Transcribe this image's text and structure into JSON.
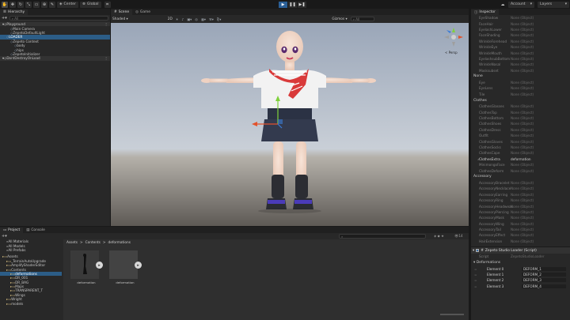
{
  "toolbar": {
    "tools": [
      "hand-icon",
      "move-icon",
      "rotate-icon",
      "scale-icon",
      "rect-icon",
      "transform-icon",
      "custom-icon"
    ],
    "pivot_label": "Center",
    "space_label": "Global",
    "account_label": "Account",
    "layers_label": "Layers"
  },
  "hierarchy": {
    "tab": "Hierarchy",
    "search_placeholder": "All",
    "items": [
      {
        "label": "Playground",
        "depth": 0,
        "selected": false,
        "scene": true
      },
      {
        "label": "Main Camera",
        "depth": 2,
        "selected": false
      },
      {
        "label": "ZepetoDefaultLight",
        "depth": 2,
        "selected": false
      },
      {
        "label": "LOADER",
        "depth": 1,
        "selected": true
      },
      {
        "label": "Zepeto Context",
        "depth": 2,
        "selected": false
      },
      {
        "label": "body",
        "depth": 3,
        "selected": false
      },
      {
        "label": "hips",
        "depth": 3,
        "selected": false
      },
      {
        "label": "ZepetoInitializer",
        "depth": 2,
        "selected": false
      },
      {
        "label": "DontDestroyOnLoad",
        "depth": 0,
        "selected": false,
        "scene": true
      }
    ]
  },
  "scene_view": {
    "tabs": [
      "Scene",
      "Game"
    ],
    "shading": "Shaded",
    "dim": "2D",
    "gizmos": "Gizmos",
    "search_placeholder": "All",
    "gizmo_label": "< Persp"
  },
  "inspector": {
    "tab": "Inspector",
    "none_value": "None (Object)",
    "groups": [
      {
        "header": "",
        "rows": [
          "EyeShadow",
          "FaceHair",
          "EyelashLower",
          "FaceShading",
          "WrinkleForehead",
          "WrinkleEye",
          "WrinkleMouth",
          "EyelashsubBottom",
          "WrinkleNasal",
          "Masksubset"
        ]
      },
      {
        "header": "None",
        "rows": [
          "Eye",
          "EyeLens",
          "Tile"
        ]
      },
      {
        "header": "Clothes",
        "rows": [
          "ClothesGlasses",
          "ClothesTop",
          "ClothesBottom",
          "ClothesShoes",
          "ClothesDress",
          "Outfit",
          "ClothesGloves",
          "ClothesSocks",
          "ClothesCape",
          "ClothesExtra",
          "MinimongoFace",
          "ClothesDeform"
        ]
      },
      {
        "header": "Accessory",
        "rows": [
          "AccessoryBracelet",
          "AccessoryNecklace",
          "AccessoryEarring",
          "AccessoryRing",
          "AccessoryHeadwear",
          "AccessoryPiercing",
          "AccessoryMask",
          "AccessoryWing",
          "AccessoryTail",
          "AccessoryEffect",
          "HairExtension"
        ]
      }
    ],
    "highlighted_row": "ClothesExtra",
    "highlighted_value": "deformation",
    "component_title": "Zepeto Studio Loader (Script)",
    "script_label": "Script",
    "script_value": "ZepetoStudioLoader",
    "deformations_label": "Deformations",
    "elements": [
      {
        "k": "Element 0",
        "v": "DEFORM_1"
      },
      {
        "k": "Element 1",
        "v": "DEFORM_2"
      },
      {
        "k": "Element 2",
        "v": "DEFORM_3"
      },
      {
        "k": "Element 3",
        "v": "DEFORM_4"
      }
    ]
  },
  "project": {
    "tabs": [
      "Project",
      "Console"
    ],
    "breadcrumb": [
      "Assets",
      "Contents",
      "deformations"
    ],
    "favorites": [
      "All Materials",
      "All Models",
      "All Prefabs"
    ],
    "tree": [
      {
        "label": "Assets",
        "depth": 0
      },
      {
        "label": "_TerrainAutoUpgrade",
        "depth": 1
      },
      {
        "label": "AmplifyShaderEditor",
        "depth": 1
      },
      {
        "label": "Contents",
        "depth": 1
      },
      {
        "label": "deformations",
        "depth": 2,
        "selected": true
      },
      {
        "label": "DR_001",
        "depth": 2
      },
      {
        "label": "DR_BAG",
        "depth": 2
      },
      {
        "label": "Maps",
        "depth": 2
      },
      {
        "label": "TRANSPARENT_T",
        "depth": 2
      },
      {
        "label": "Wings",
        "depth": 2
      },
      {
        "label": "Wright",
        "depth": 1
      },
      {
        "label": "models",
        "depth": 1
      }
    ],
    "assets": [
      {
        "label": "deformation"
      },
      {
        "label": "deformation"
      }
    ],
    "count_label": "14"
  }
}
